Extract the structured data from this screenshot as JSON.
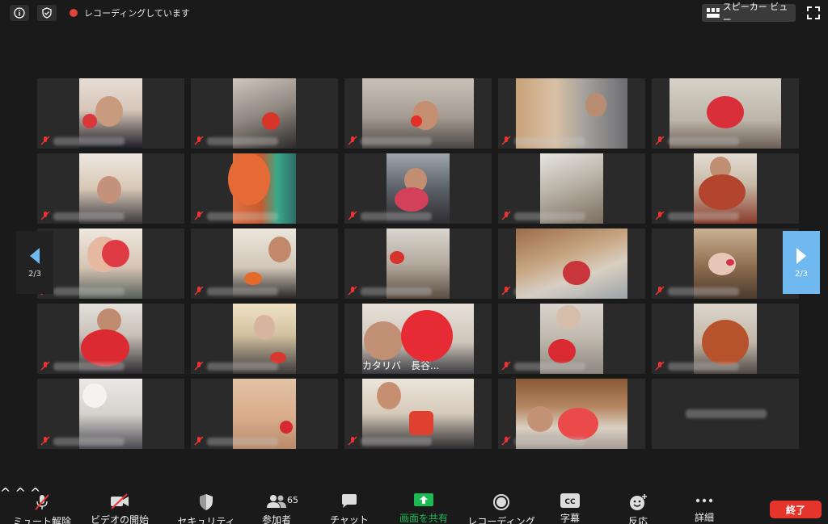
{
  "topbar": {
    "recording_label": "レコーディングしています",
    "speaker_view_label": "スピーカー ビュー"
  },
  "pager": {
    "left_page": "2/3",
    "right_page": "2/3"
  },
  "grid": {
    "named_tile_label": "カタリバ　長谷..."
  },
  "toolbar": {
    "unmute_label": "ミュート解除",
    "start_video_label": "ビデオの開始",
    "security_label": "セキュリティ",
    "participants_label": "参加者",
    "participants_count": "65",
    "chat_label": "チャット",
    "share_label": "画面を共有",
    "record_label": "レコーディング",
    "cc_label": "字幕",
    "cc_icon_text": "CC",
    "react_label": "反応",
    "more_label": "詳細",
    "end_label": "終了"
  },
  "colors": {
    "background": "#1a1a1a",
    "tile": "#2a2a2a",
    "share_green": "#1db954",
    "end_red": "#e5342b",
    "pager_blue": "#6fb8f0",
    "record_red": "#e0433c"
  }
}
